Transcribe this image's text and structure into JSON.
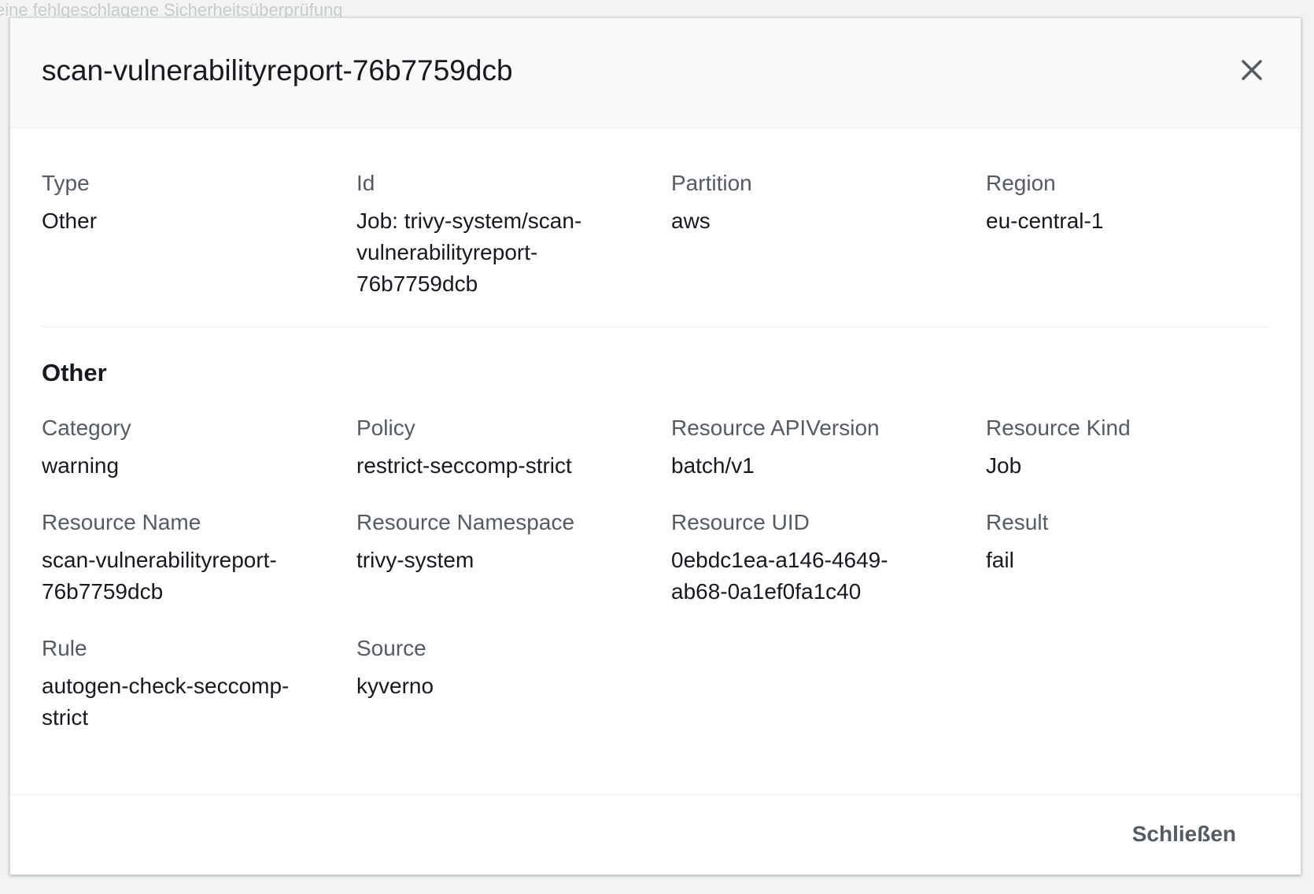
{
  "background": {
    "text": "eine fehlgeschlagene Sicherheitsüberprüfung"
  },
  "modal": {
    "title": "scan-vulnerabilityreport-76b7759dcb",
    "close_icon": "close-icon",
    "summary": [
      {
        "label": "Type",
        "value": "Other"
      },
      {
        "label": "Id",
        "value": "Job: trivy-system/scan-vulnerabilityreport-76b7759dcb"
      },
      {
        "label": "Partition",
        "value": "aws"
      },
      {
        "label": "Region",
        "value": "eu-central-1"
      }
    ],
    "section": {
      "heading": "Other",
      "fields": [
        {
          "label": "Category",
          "value": "warning"
        },
        {
          "label": "Policy",
          "value": "restrict-seccomp-strict"
        },
        {
          "label": "Resource APIVersion",
          "value": "batch/v1"
        },
        {
          "label": "Resource Kind",
          "value": "Job"
        },
        {
          "label": "Resource Name",
          "value": "scan-vulnerabilityreport-76b7759dcb"
        },
        {
          "label": "Resource Namespace",
          "value": "trivy-system"
        },
        {
          "label": "Resource UID",
          "value": "0ebdc1ea-a146-4649-ab68-0a1ef0fa1c40"
        },
        {
          "label": "Result",
          "value": "fail"
        },
        {
          "label": "Rule",
          "value": "autogen-check-seccomp-strict"
        },
        {
          "label": "Source",
          "value": "kyverno"
        }
      ]
    },
    "footer": {
      "close_label": "Schließen"
    }
  }
}
